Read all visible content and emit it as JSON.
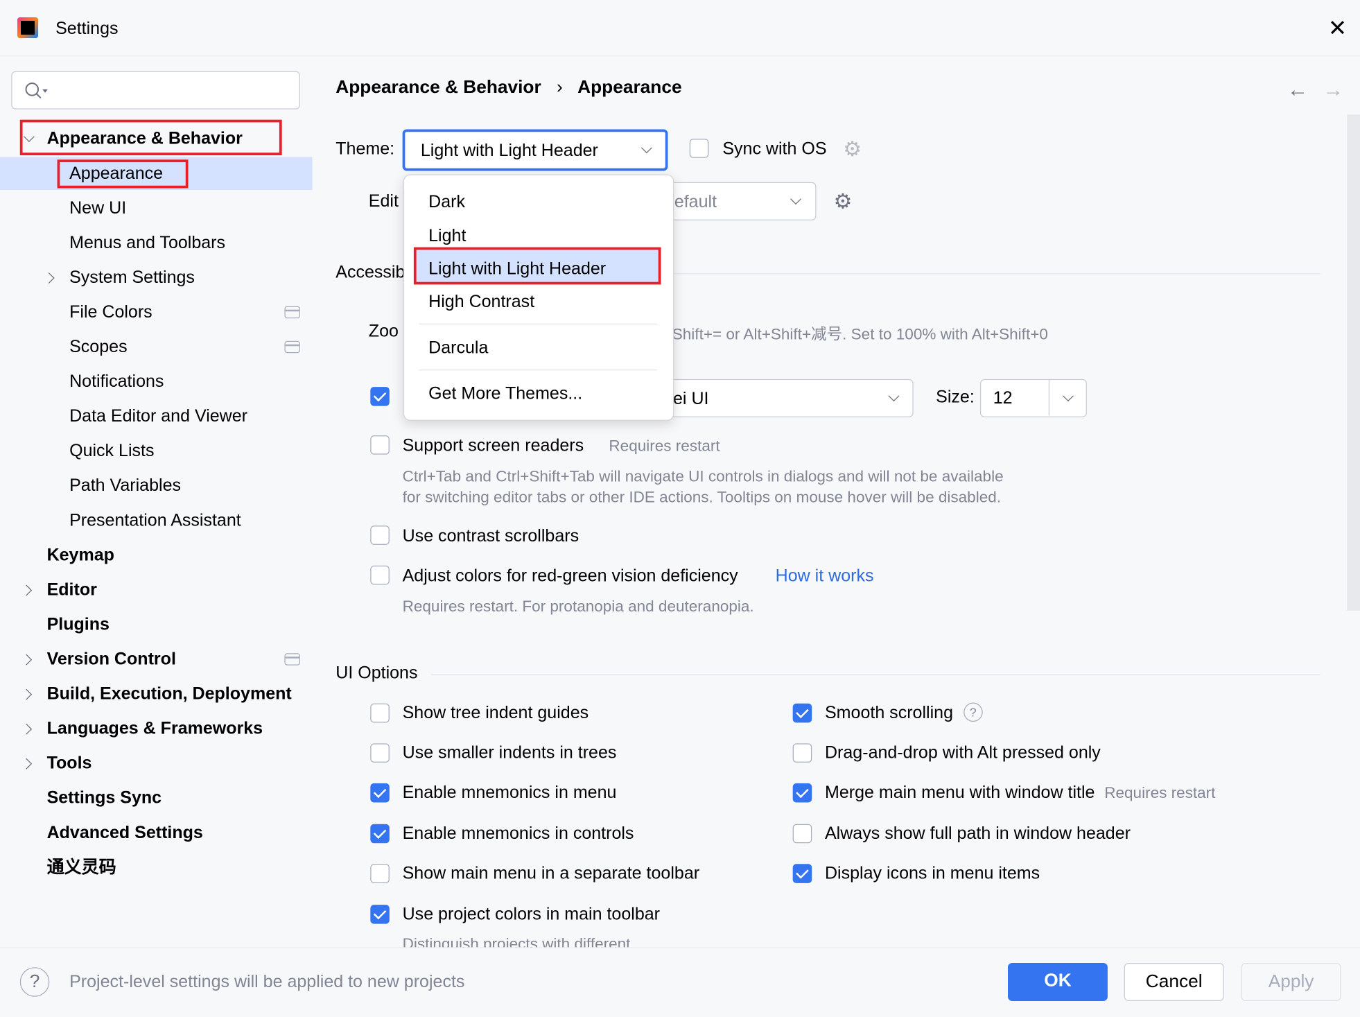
{
  "window": {
    "title": "Settings",
    "app_icon": "intellij-idea-icon",
    "close_icon": "close-icon"
  },
  "sidebar": {
    "search_placeholder": "",
    "items": [
      {
        "label": "Appearance & Behavior",
        "level": 0,
        "expanded": true,
        "highlighted": true
      },
      {
        "label": "Appearance",
        "level": 1,
        "selected": true,
        "highlighted": true
      },
      {
        "label": "New UI",
        "level": 1
      },
      {
        "label": "Menus and Toolbars",
        "level": 1
      },
      {
        "label": "System Settings",
        "level": 1,
        "expandable": true
      },
      {
        "label": "File Colors",
        "level": 1,
        "project_icon": true
      },
      {
        "label": "Scopes",
        "level": 1,
        "project_icon": true
      },
      {
        "label": "Notifications",
        "level": 1
      },
      {
        "label": "Data Editor and Viewer",
        "level": 1
      },
      {
        "label": "Quick Lists",
        "level": 1
      },
      {
        "label": "Path Variables",
        "level": 1
      },
      {
        "label": "Presentation Assistant",
        "level": 1
      },
      {
        "label": "Keymap",
        "level": 0
      },
      {
        "label": "Editor",
        "level": 0,
        "expandable": true
      },
      {
        "label": "Plugins",
        "level": 0
      },
      {
        "label": "Version Control",
        "level": 0,
        "expandable": true,
        "project_icon": true
      },
      {
        "label": "Build, Execution, Deployment",
        "level": 0,
        "expandable": true
      },
      {
        "label": "Languages & Frameworks",
        "level": 0,
        "expandable": true
      },
      {
        "label": "Tools",
        "level": 0,
        "expandable": true
      },
      {
        "label": "Settings Sync",
        "level": 0
      },
      {
        "label": "Advanced Settings",
        "level": 0
      },
      {
        "label": "通义灵码",
        "level": 0
      }
    ]
  },
  "breadcrumb": {
    "parent": "Appearance & Behavior",
    "current": "Appearance"
  },
  "theme": {
    "label": "Theme:",
    "value": "Light with Light Header",
    "sync_label": "Sync with OS",
    "sync_checked": false,
    "options": [
      "Dark",
      "Light",
      "Light with Light Header",
      "High Contrast",
      "Darcula",
      "Get More Themes..."
    ],
    "selected_option": "Light with Light Header"
  },
  "editor_scheme": {
    "label_partial": "Edit",
    "value_partial": "lefault"
  },
  "accessibility": {
    "header_partial": "Accessib",
    "zoom_label_partial": "Zoo",
    "zoom_hint_partial": "Shift+= or Alt+Shift+减号. Set to 100% with Alt+Shift+0",
    "font_checked": true,
    "font_value_partial": "ei UI",
    "size_label": "Size:",
    "size_value": "12",
    "screen_readers": {
      "label": "Support screen readers",
      "checked": false,
      "note": "Requires restart",
      "desc1": "Ctrl+Tab and Ctrl+Shift+Tab will navigate UI controls in dialogs and will not be available",
      "desc2": "for switching editor tabs or other IDE actions. Tooltips on mouse hover will be disabled."
    },
    "contrast_scrollbars": {
      "label": "Use contrast scrollbars",
      "checked": false
    },
    "color_deficiency": {
      "label": "Adjust colors for red-green vision deficiency",
      "checked": false,
      "link": "How it works",
      "desc": "Requires restart. For protanopia and deuteranopia."
    }
  },
  "ui_options": {
    "header": "UI Options",
    "left": [
      {
        "label": "Show tree indent guides",
        "checked": false
      },
      {
        "label": "Use smaller indents in trees",
        "checked": false
      },
      {
        "label": "Enable mnemonics in menu",
        "checked": true
      },
      {
        "label": "Enable mnemonics in controls",
        "checked": true
      },
      {
        "label": "Show main menu in a separate toolbar",
        "checked": false
      },
      {
        "label": "Use project colors in main toolbar",
        "checked": true
      }
    ],
    "left_desc_partial": "Distinguish projects with different",
    "right": [
      {
        "label": "Smooth scrolling",
        "checked": true,
        "help": true
      },
      {
        "label": "Drag-and-drop with Alt pressed only",
        "checked": false
      },
      {
        "label": "Merge main menu with window title",
        "checked": true,
        "note": "Requires restart"
      },
      {
        "label": "Always show full path in window header",
        "checked": false
      },
      {
        "label": "Display icons in menu items",
        "checked": true
      }
    ]
  },
  "footer": {
    "hint": "Project-level settings will be applied to new projects",
    "ok": "OK",
    "cancel": "Cancel",
    "apply": "Apply"
  },
  "colors": {
    "accent": "#3574f0",
    "selection": "#d4e2ff",
    "highlight_box": "#e8202a",
    "link": "#2f6be0"
  }
}
